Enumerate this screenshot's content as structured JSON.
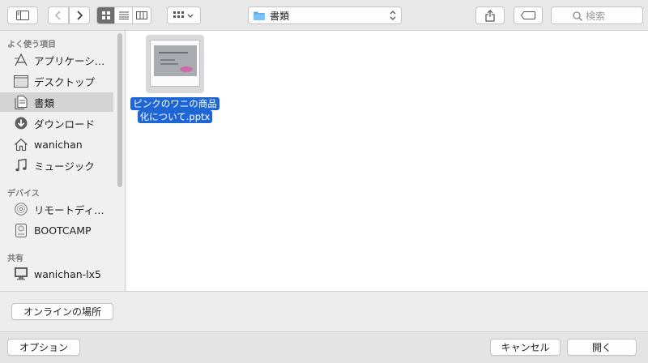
{
  "toolbar": {
    "path_folder": "書類",
    "search_placeholder": "検索"
  },
  "sidebar": {
    "sections": {
      "favorites": "よく使う項目",
      "devices": "デバイス",
      "shared": "共有"
    },
    "favorites": [
      {
        "label": "アプリケーション",
        "icon": "applications-icon"
      },
      {
        "label": "デスクトップ",
        "icon": "desktop-icon"
      },
      {
        "label": "書類",
        "icon": "documents-icon",
        "selected": true
      },
      {
        "label": "ダウンロード",
        "icon": "downloads-icon"
      },
      {
        "label": "wanichan",
        "icon": "home-icon"
      },
      {
        "label": "ミュージック",
        "icon": "music-icon"
      }
    ],
    "devices": [
      {
        "label": "リモートディスク",
        "icon": "remote-disc-icon"
      },
      {
        "label": "BOOTCAMP",
        "icon": "drive-icon"
      }
    ],
    "shared": [
      {
        "label": "wanichan-lx5",
        "icon": "computer-icon"
      }
    ]
  },
  "files": [
    {
      "name_line1": "ピンクのワニの商品",
      "name_line2": "化について.pptx",
      "selected": true
    }
  ],
  "buttons": {
    "online_locations": "オンラインの場所",
    "options": "オプション",
    "cancel": "キャンセル",
    "open": "開く"
  },
  "colors": {
    "selection": "#1e66d6",
    "folder": "#5aaef0"
  }
}
